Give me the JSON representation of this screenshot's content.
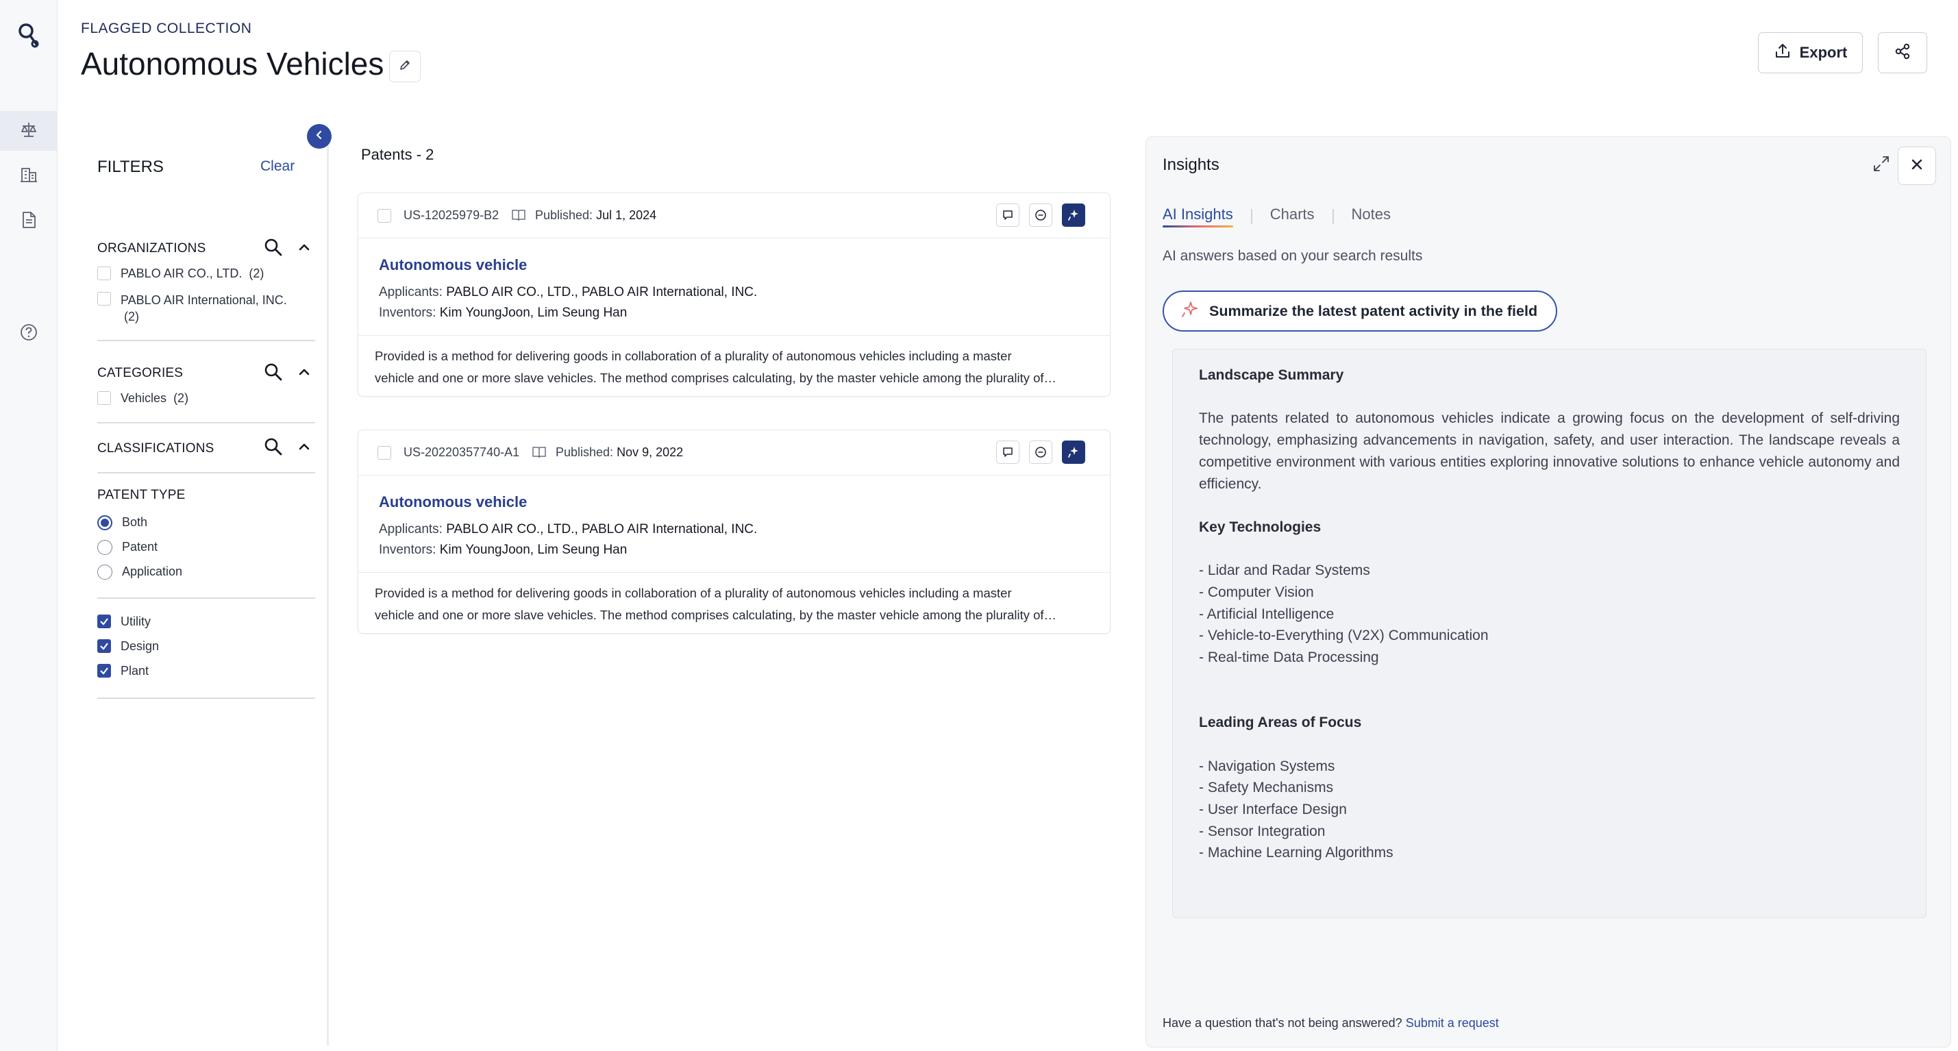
{
  "header": {
    "eyebrow": "FLAGGED COLLECTION",
    "title": "Autonomous Vehicles",
    "export_label": "Export"
  },
  "filters": {
    "title": "FILTERS",
    "clear_label": "Clear",
    "organizations": {
      "label": "ORGANIZATIONS",
      "options": [
        {
          "label": "PABLO AIR CO., LTD.",
          "count": "(2)"
        },
        {
          "label": "PABLO AIR International, INC.",
          "count": "(2)"
        }
      ]
    },
    "categories": {
      "label": "CATEGORIES",
      "options": [
        {
          "label": "Vehicles",
          "count": "(2)"
        }
      ]
    },
    "classifications": {
      "label": "CLASSIFICATIONS"
    },
    "patent_type": {
      "label": "PATENT TYPE",
      "radios": [
        {
          "label": "Both",
          "selected": true
        },
        {
          "label": "Patent",
          "selected": false
        },
        {
          "label": "Application",
          "selected": false
        }
      ],
      "checks": [
        {
          "label": "Utility",
          "checked": true
        },
        {
          "label": "Design",
          "checked": true
        },
        {
          "label": "Plant",
          "checked": true
        }
      ]
    }
  },
  "patents": {
    "title": "Patents - 2",
    "items": [
      {
        "number": "US-12025979-B2",
        "published_label": "Published:",
        "published_date": "Jul 1, 2024",
        "title": "Autonomous vehicle",
        "applicants_label": "Applicants:",
        "applicants": "PABLO AIR CO., LTD., PABLO AIR International, INC.",
        "inventors_label": "Inventors:",
        "inventors": "Kim YoungJoon, Lim Seung Han",
        "abstract_line1": "Provided is a method for delivering goods in collaboration of a plurality of autonomous vehicles including a master",
        "abstract_line2": "vehicle and one or more slave vehicles. The method comprises calculating, by the master vehicle among the plurality of…"
      },
      {
        "number": "US-20220357740-A1",
        "published_label": "Published:",
        "published_date": "Nov 9, 2022",
        "title": "Autonomous vehicle",
        "applicants_label": "Applicants:",
        "applicants": "PABLO AIR CO., LTD., PABLO AIR International, INC.",
        "inventors_label": "Inventors:",
        "inventors": "Kim YoungJoon, Lim Seung Han",
        "abstract_line1": "Provided is a method for delivering goods in collaboration of a plurality of autonomous vehicles including a master",
        "abstract_line2": "vehicle and one or more slave vehicles. The method comprises calculating, by the master vehicle among the plurality of…"
      }
    ]
  },
  "insights": {
    "title": "Insights",
    "tabs": [
      "AI Insights",
      "Charts",
      "Notes"
    ],
    "subtitle": "AI answers based on your search results",
    "summarize_button": "Summarize the latest patent activity in the field",
    "summary": {
      "heading1": "Landscape Summary",
      "paragraph": "The patents related to autonomous vehicles indicate a growing focus on the development of self-driving technology, emphasizing advancements in navigation, safety, and user interaction. The landscape reveals a competitive environment with various entities exploring innovative solutions to enhance vehicle autonomy and efficiency.",
      "heading2": "Key Technologies",
      "tech": [
        "- Lidar and Radar Systems",
        "- Computer Vision",
        "- Artificial Intelligence",
        "- Vehicle-to-Everything (V2X) Communication",
        "- Real-time Data Processing"
      ],
      "heading3": "Leading Areas of Focus",
      "areas": [
        "- Navigation Systems",
        "- Safety Mechanisms",
        "- User Interface Design",
        "- Sensor Integration",
        "- Machine Learning Algorithms"
      ]
    },
    "footer_text": "Have a question that's not being answered?",
    "footer_link": "Submit a request"
  },
  "colors": {
    "brand": "#2f4aa0",
    "link": "#2a4a9e",
    "ai_action": "#1e3474"
  },
  "icons": {
    "rail": [
      "app-logo-icon",
      "balance-scale-icon",
      "building-icon",
      "document-icon",
      "help-icon"
    ]
  }
}
